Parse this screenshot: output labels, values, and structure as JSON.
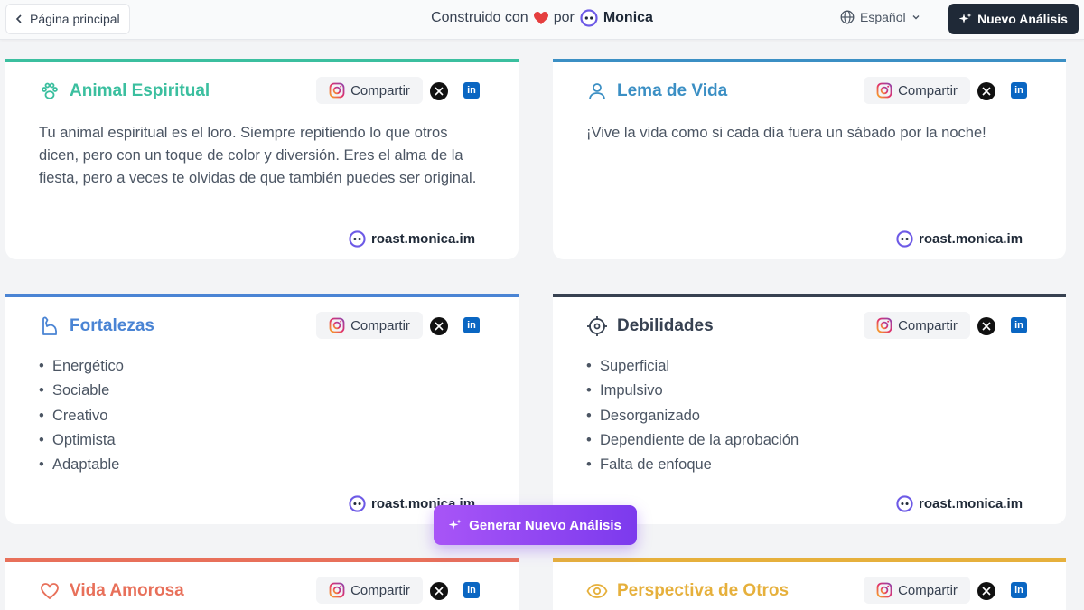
{
  "header": {
    "back_label": "Página principal",
    "built_with": "Construido con",
    "by": "por",
    "brand": "Monica",
    "language": "Español",
    "new_analysis": "Nuevo Análisis"
  },
  "share_label": "Compartir",
  "watermark": "roast.monica.im",
  "cards": {
    "spirit": {
      "title": "Animal Espiritual",
      "color": "#3bbf9f",
      "icon": "paw-icon",
      "text": "Tu animal espiritual es el loro. Siempre repitiendo lo que otros dicen, pero con un toque de color y diversión. Eres el alma de la fiesta, pero a veces te olvidas de que también puedes ser original."
    },
    "motto": {
      "title": "Lema de Vida",
      "color": "#3b8fc4",
      "icon": "user-icon",
      "text": "¡Vive la vida como si cada día fuera un sábado por la noche!"
    },
    "strengths": {
      "title": "Fortalezas",
      "color": "#4a84d4",
      "icon": "flexed-arm-icon",
      "items": [
        "Energético",
        "Sociable",
        "Creativo",
        "Optimista",
        "Adaptable"
      ]
    },
    "weaknesses": {
      "title": "Debilidades",
      "color": "#374151",
      "icon": "crosshair-icon",
      "items": [
        "Superficial",
        "Impulsivo",
        "Desorganizado",
        "Dependiente de la aprobación",
        "Falta de enfoque"
      ]
    },
    "love": {
      "title": "Vida Amorosa",
      "color": "#e8705a",
      "icon": "heart-icon"
    },
    "others": {
      "title": "Perspectiva de Otros",
      "color": "#e6b03c",
      "icon": "eye-icon"
    }
  },
  "floating_button": "Generar Nuevo Análisis"
}
